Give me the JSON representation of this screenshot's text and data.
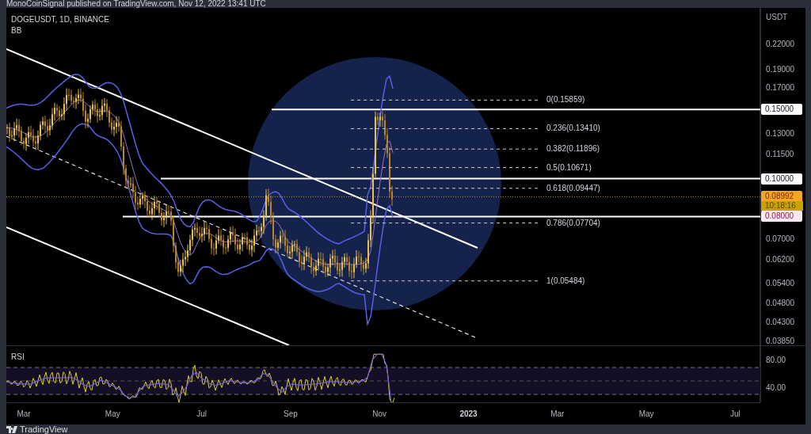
{
  "header": {
    "text": "MonoCoinSignal published on TradingView.com, Nov 12, 2022 13:41 UTC"
  },
  "legend": {
    "symbol": "DOGEUSDT, 1D, BINANCE",
    "indicator": "BB"
  },
  "fib_levels": [
    {
      "label": "0(0.15859)"
    },
    {
      "label": "0.236(0.13410)"
    },
    {
      "label": "0.382(0.11896)"
    },
    {
      "label": "0.5(0.10671)"
    },
    {
      "label": "0.618(0.09447)"
    },
    {
      "label": "0.786(0.07704)"
    },
    {
      "label": "1(0.05484)"
    }
  ],
  "price_axis": {
    "currency": "USDT",
    "ticks": [
      "0.22000",
      "0.19000",
      "0.17000",
      "0.13000",
      "0.11500",
      "0.07000",
      "0.06200",
      "0.05400",
      "0.04800",
      "0.04300",
      "0.03850"
    ],
    "badges": [
      {
        "kind": "level",
        "price": "0.15000"
      },
      {
        "kind": "level",
        "price": "0.10000"
      },
      {
        "kind": "last",
        "price": "0.08992",
        "countdown": "10:18:16"
      },
      {
        "kind": "alert",
        "price": "0.08000"
      }
    ]
  },
  "rsi": {
    "label": "RSI",
    "ticks": [
      "80.00",
      "40.00"
    ]
  },
  "time_axis": [
    {
      "label": "Mar",
      "kind": "month"
    },
    {
      "label": "May",
      "kind": "month"
    },
    {
      "label": "Jul",
      "kind": "month"
    },
    {
      "label": "Sep",
      "kind": "month"
    },
    {
      "label": "Nov",
      "kind": "month"
    },
    {
      "label": "2023",
      "kind": "year"
    },
    {
      "label": "Mar",
      "kind": "month"
    },
    {
      "label": "May",
      "kind": "month"
    },
    {
      "label": "Jul",
      "kind": "month"
    }
  ],
  "footer": {
    "brand": "TradingView"
  }
}
